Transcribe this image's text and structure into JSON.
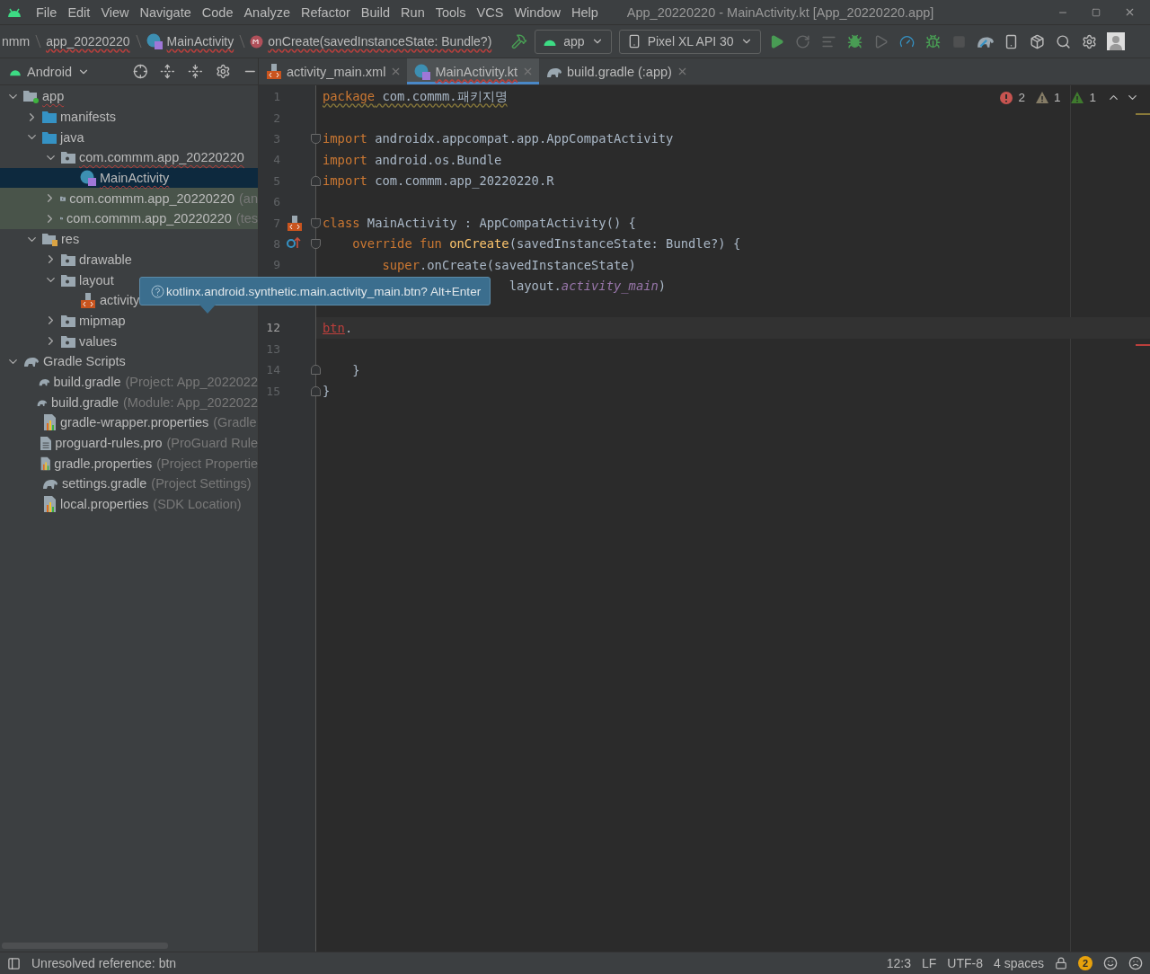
{
  "menu": [
    "File",
    "Edit",
    "View",
    "Navigate",
    "Code",
    "Analyze",
    "Refactor",
    "Build",
    "Run",
    "Tools",
    "VCS",
    "Window",
    "Help"
  ],
  "window": {
    "title": "App_20220220 - MainActivity.kt [App_20220220.app]"
  },
  "breadcrumbs": [
    {
      "kind": "text",
      "label": "nmm",
      "error": false
    },
    {
      "kind": "text",
      "label": "app_20220220",
      "error": true
    },
    {
      "kind": "class",
      "label": "MainActivity",
      "error": true
    },
    {
      "kind": "method",
      "label": "onCreate(savedInstanceState: Bundle?)",
      "error": true
    }
  ],
  "run_config": {
    "label": "app"
  },
  "device": {
    "label": "Pixel XL API 30"
  },
  "toolbar": [
    {
      "kind": "run",
      "disabled": false
    },
    {
      "kind": "rerun",
      "disabled": true
    },
    {
      "kind": "apply",
      "disabled": true
    },
    {
      "kind": "debug",
      "disabled": false
    },
    {
      "kind": "attach",
      "disabled": true
    },
    {
      "kind": "profile",
      "disabled": false
    },
    {
      "kind": "attach-debug",
      "disabled": false
    },
    {
      "kind": "stop",
      "disabled": true
    },
    {
      "kind": "sync",
      "disabled": false
    },
    {
      "kind": "device",
      "disabled": false
    },
    {
      "kind": "sdk",
      "disabled": false
    },
    {
      "kind": "search",
      "disabled": false
    },
    {
      "kind": "settings",
      "disabled": false
    },
    {
      "kind": "avatar",
      "disabled": false
    }
  ],
  "project_view": {
    "label": "Android"
  },
  "tree": [
    {
      "label": "app",
      "kind": "module",
      "expanded": true,
      "selected": false,
      "error": true,
      "tinted": false,
      "children": [
        {
          "label": "manifests",
          "kind": "folder",
          "expanded": false,
          "selected": false,
          "error": false,
          "tinted": false
        },
        {
          "label": "java",
          "kind": "folder",
          "expanded": true,
          "selected": false,
          "error": false,
          "tinted": false,
          "children": [
            {
              "label": "com.commm.app_20220220",
              "kind": "package",
              "expanded": true,
              "selected": false,
              "error": true,
              "tinted": false,
              "children": [
                {
                  "label": "MainActivity",
                  "kind": "kotlin",
                  "selected": true,
                  "error": true,
                  "tinted": false
                }
              ]
            },
            {
              "label": "com.commm.app_20220220",
              "hint": "(an",
              "kind": "package",
              "expanded": false,
              "selected": false,
              "error": false,
              "tinted": true
            },
            {
              "label": "com.commm.app_20220220",
              "hint": "(tes",
              "kind": "package",
              "expanded": false,
              "selected": false,
              "error": false,
              "tinted": true
            }
          ]
        },
        {
          "label": "res",
          "kind": "res",
          "expanded": true,
          "selected": false,
          "error": false,
          "tinted": false,
          "children": [
            {
              "label": "drawable",
              "kind": "package",
              "expanded": false,
              "selected": false,
              "error": false,
              "tinted": false
            },
            {
              "label": "layout",
              "kind": "package",
              "expanded": true,
              "selected": false,
              "error": false,
              "tinted": false,
              "children": [
                {
                  "label": "activity",
                  "kind": "xml",
                  "selected": false,
                  "error": false,
                  "tinted": false
                }
              ]
            },
            {
              "label": "mipmap",
              "kind": "package",
              "expanded": false,
              "selected": false,
              "error": false,
              "tinted": false
            },
            {
              "label": "values",
              "kind": "package",
              "expanded": false,
              "selected": false,
              "error": false,
              "tinted": false
            }
          ]
        }
      ]
    },
    {
      "label": "Gradle Scripts",
      "kind": "gradle",
      "expanded": true,
      "selected": false,
      "error": false,
      "tinted": false,
      "children": [
        {
          "label": "build.gradle",
          "hint": "(Project: App_2022022",
          "kind": "gradle",
          "selected": false,
          "error": false,
          "tinted": false
        },
        {
          "label": "build.gradle",
          "hint": "(Module: App_2022022",
          "kind": "gradle",
          "selected": false,
          "error": false,
          "tinted": false
        },
        {
          "label": "gradle-wrapper.properties",
          "hint": "(Gradle",
          "kind": "properties",
          "selected": false,
          "error": false,
          "tinted": false
        },
        {
          "label": "proguard-rules.pro",
          "hint": "(ProGuard Rule",
          "kind": "text",
          "selected": false,
          "error": false,
          "tinted": false
        },
        {
          "label": "gradle.properties",
          "hint": "(Project Propertie",
          "kind": "properties",
          "selected": false,
          "error": false,
          "tinted": false
        },
        {
          "label": "settings.gradle",
          "hint": "(Project Settings)",
          "kind": "gradle",
          "selected": false,
          "error": false,
          "tinted": false
        },
        {
          "label": "local.properties",
          "hint": "(SDK Location)",
          "kind": "properties",
          "selected": false,
          "error": false,
          "tinted": false
        }
      ]
    }
  ],
  "tabs": [
    {
      "label": "activity_main.xml",
      "kind": "xml",
      "selected": false,
      "error": false
    },
    {
      "label": "MainActivity.kt",
      "kind": "kotlin",
      "selected": true,
      "error": true
    },
    {
      "label": "build.gradle (:app)",
      "kind": "gradle",
      "selected": false,
      "error": false
    }
  ],
  "inspections": {
    "errors": "2",
    "warnings": "1",
    "weak_warnings": "1"
  },
  "code": [
    {
      "number": "1",
      "kind": "plain",
      "warning": true,
      "tokens": [
        {
          "kind": "keyword",
          "text": "package"
        },
        {
          "kind": "plain",
          "text": " com.commm.패키지명"
        }
      ]
    },
    {
      "number": "2",
      "kind": "plain"
    },
    {
      "number": "3",
      "kind": "fold-start",
      "tokens": [
        {
          "kind": "keyword",
          "text": "import"
        },
        {
          "kind": "plain",
          "text": " androidx.appcompat.app.AppCompatActivity"
        }
      ]
    },
    {
      "number": "4",
      "kind": "plain",
      "tokens": [
        {
          "kind": "keyword",
          "text": "import"
        },
        {
          "kind": "plain",
          "text": " android.os.Bundle"
        }
      ]
    },
    {
      "number": "5",
      "kind": "fold-end",
      "tokens": [
        {
          "kind": "keyword",
          "text": "import"
        },
        {
          "kind": "plain",
          "text": " com.commm.app_20220220.R"
        }
      ]
    },
    {
      "number": "6",
      "kind": "plain"
    },
    {
      "number": "7",
      "kind": "fold-start",
      "gutter": {
        "kind": "xml"
      },
      "tokens": [
        {
          "kind": "keyword",
          "text": "class"
        },
        {
          "kind": "plain",
          "text": " MainActivity : AppCompatActivity() {"
        }
      ]
    },
    {
      "number": "8",
      "kind": "fold-start",
      "gutter": {
        "kind": "override"
      },
      "tokens": [
        {
          "kind": "keyword",
          "text": "    override fun"
        },
        {
          "kind": "function",
          "text": " onCreate"
        },
        {
          "kind": "plain",
          "text": "(savedInstanceState: Bundle?) {"
        }
      ]
    },
    {
      "number": "9",
      "kind": "plain",
      "tokens": [
        {
          "kind": "keyword",
          "text": "        super"
        },
        {
          "kind": "plain",
          "text": ".onCreate(savedInstanceState)"
        }
      ]
    },
    {
      "kind": "plain",
      "tokens": [
        {
          "kind": "plain",
          "text": "                         layout."
        },
        {
          "kind": "field",
          "text": "activity_main"
        },
        {
          "kind": "plain",
          "text": ")"
        }
      ]
    },
    {
      "kind": "plain"
    },
    {
      "number": "12",
      "kind": "plain",
      "current": true,
      "tokens": [
        {
          "kind": "error",
          "text": "btn"
        },
        {
          "kind": "plain",
          "text": "."
        }
      ]
    },
    {
      "number": "13",
      "kind": "plain"
    },
    {
      "number": "14",
      "kind": "fold-end",
      "tokens": [
        {
          "kind": "plain",
          "text": "    }"
        }
      ]
    },
    {
      "number": "15",
      "kind": "fold-end",
      "tokens": [
        {
          "kind": "plain",
          "text": "}"
        }
      ]
    }
  ],
  "tooltip": {
    "text": "kotlinx.android.synthetic.main.activity_main.btn? Alt+Enter"
  },
  "status_bar": {
    "message": "Unresolved reference: btn",
    "position": "12:3",
    "line_separator": "LF",
    "encoding": "UTF-8",
    "indent": "4 spaces",
    "notifications": "2"
  }
}
